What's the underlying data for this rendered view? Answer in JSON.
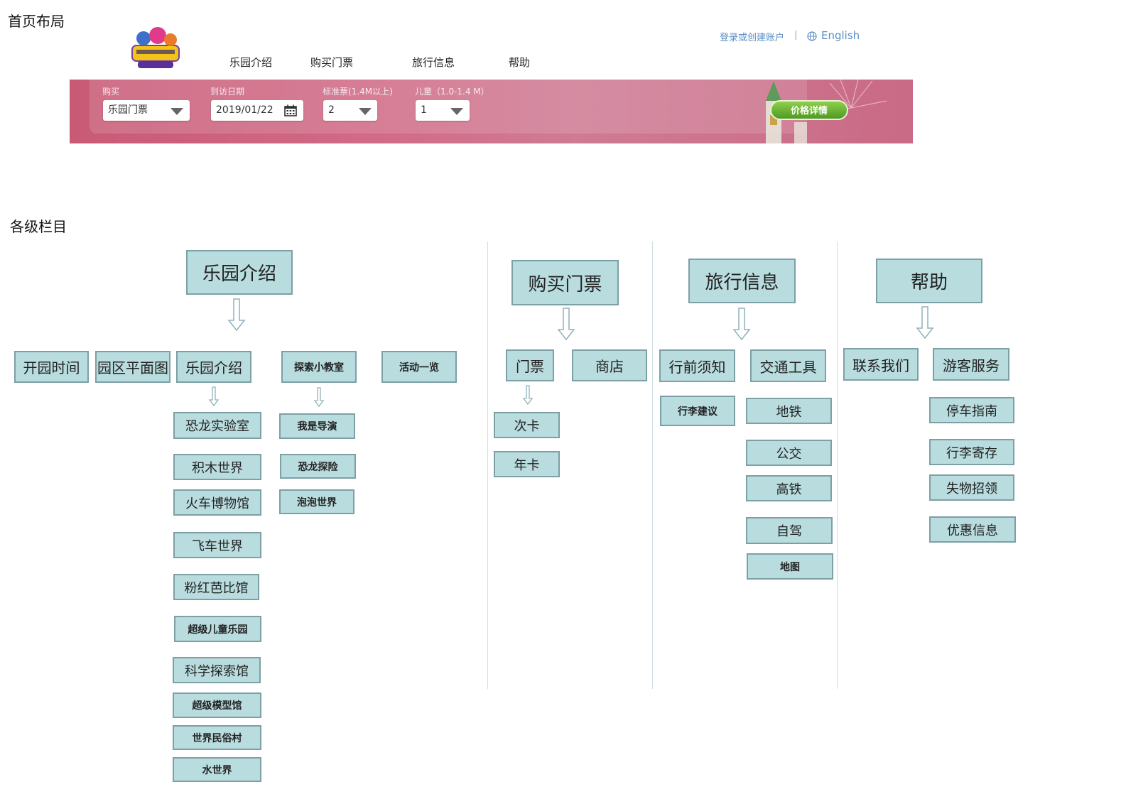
{
  "labels": {
    "homepage_layout": "首页布局",
    "sections": "各级栏目"
  },
  "header": {
    "nav": [
      "乐园介绍",
      "购买门票",
      "旅行信息",
      "帮助"
    ],
    "login": "登录或创建账户",
    "separator": "|",
    "language": "English"
  },
  "booking_bar": {
    "buy_label": "购买",
    "buy_value": "乐园门票",
    "date_label": "到访日期",
    "date_value": "2019/01/22",
    "adult_label": "标准票(1.4M以上)",
    "adult_value": "2",
    "child_label": "儿童（1.0-1.4 M）",
    "child_value": "1",
    "price_button": "价格详情"
  },
  "diagram": {
    "park": {
      "title": "乐园介绍",
      "children": [
        "开园时间",
        "园区平面图",
        "乐园介绍",
        "探索小教室",
        "活动一览"
      ],
      "intro_children": [
        "恐龙实验室",
        "积木世界",
        "火车博物馆",
        "飞车世界",
        "粉红芭比馆",
        "超级儿童乐园",
        "科学探索馆",
        "超级模型馆",
        "世界民俗村",
        "水世界"
      ],
      "explore_children": [
        "我是导演",
        "恐龙探险",
        "泡泡世界"
      ]
    },
    "tickets": {
      "title": "购买门票",
      "children": [
        "门票",
        "商店"
      ],
      "ticket_children": [
        "次卡",
        "年卡"
      ]
    },
    "travel": {
      "title": "旅行信息",
      "children": [
        "行前须知",
        "交通工具"
      ],
      "notice_children": [
        "行李建议"
      ],
      "transport_children": [
        "地铁",
        "公交",
        "高铁",
        "自驾",
        "地图"
      ]
    },
    "help": {
      "title": "帮助",
      "children": [
        "联系我们",
        "游客服务"
      ],
      "service_children": [
        "停车指南",
        "行李寄存",
        "失物招领",
        "优惠信息"
      ]
    }
  }
}
